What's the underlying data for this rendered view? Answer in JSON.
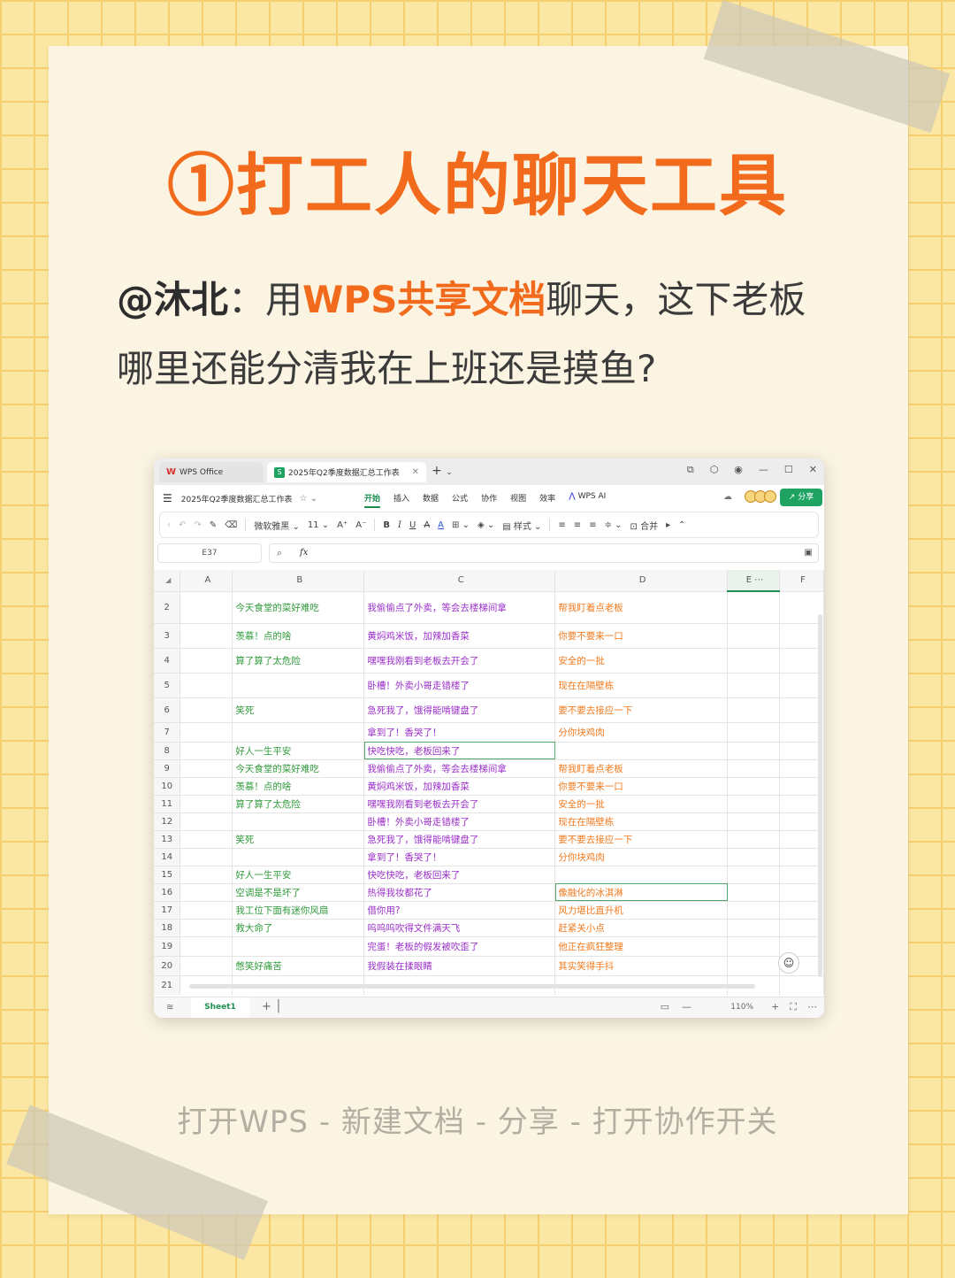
{
  "headline": "①打工人的聊天工具",
  "quote": {
    "author": "@沐北",
    "colon": "：用",
    "highlight": "WPS共享文档",
    "rest1": "聊天，这下老板",
    "line2": "哪里还能分清我在上班还是摸鱼?"
  },
  "footer_steps": "打开WPS - 新建文档 - 分享 - 打开协作开关",
  "window": {
    "tab_home": "WPS Office",
    "tab_doc": "2025年Q2季度数据汇总工作表",
    "doc_name": "2025年Q2季度数据汇总工作表",
    "menus": [
      "开始",
      "插入",
      "数据",
      "公式",
      "协作",
      "视图",
      "效率"
    ],
    "ai_label": "WPS AI",
    "share_label": "分享",
    "font_name": "微软雅黑",
    "font_size": "11",
    "style_label": "样式",
    "merge_label": "合并",
    "cell_ref": "E37",
    "fx_label": "fx",
    "sheet_name": "Sheet1",
    "zoom": "110%",
    "colors": {
      "accent": "#1ea363",
      "orange": "#f26a1b",
      "col_b": "#2f9a3a",
      "col_c": "#9b2fc9",
      "col_d": "#f07a1e"
    }
  },
  "columns": [
    "A",
    "B",
    "C",
    "D",
    "E",
    "F"
  ],
  "rows": [
    {
      "n": "2",
      "b": "今天食堂的菜好难吃",
      "c": "我偷偷点了外卖，等会去楼梯间拿",
      "d": "帮我盯着点老板"
    },
    {
      "n": "3",
      "b": "羡慕！点的啥",
      "c": "黄焖鸡米饭，加辣加香菜",
      "d": "你要不要来一口"
    },
    {
      "n": "4",
      "b": "算了算了太危险",
      "c": "嘿嘿我刚看到老板去开会了",
      "d": "安全的一批"
    },
    {
      "n": "5",
      "b": "",
      "c": "卧槽！外卖小哥走错楼了",
      "d": "现在在隔壁栋"
    },
    {
      "n": "6",
      "b": "笑死",
      "c": "急死我了，饿得能啃键盘了",
      "d": "要不要去接应一下"
    },
    {
      "n": "7",
      "b": "",
      "c": "拿到了！香哭了！",
      "d": "分你块鸡肉"
    },
    {
      "n": "8",
      "b": "好人一生平安",
      "c": "快吃快吃，老板回来了",
      "d": ""
    },
    {
      "n": "9",
      "b": "今天食堂的菜好难吃",
      "c": "我偷偷点了外卖，等会去楼梯间拿",
      "d": "帮我盯着点老板"
    },
    {
      "n": "10",
      "b": "羡慕！点的啥",
      "c": "黄焖鸡米饭，加辣加香菜",
      "d": "你要不要来一口"
    },
    {
      "n": "11",
      "b": "算了算了太危险",
      "c": "嘿嘿我刚看到老板去开会了",
      "d": "安全的一批"
    },
    {
      "n": "12",
      "b": "",
      "c": "卧槽！外卖小哥走错楼了",
      "d": "现在在隔壁栋"
    },
    {
      "n": "13",
      "b": "笑死",
      "c": "急死我了，饿得能啃键盘了",
      "d": "要不要去接应一下"
    },
    {
      "n": "14",
      "b": "",
      "c": "拿到了！香哭了！",
      "d": "分你块鸡肉"
    },
    {
      "n": "15",
      "b": "好人一生平安",
      "c": "快吃快吃，老板回来了",
      "d": ""
    },
    {
      "n": "16",
      "b": "空调是不是坏了",
      "c": "热得我妆都花了",
      "d": "像融化的冰淇淋"
    },
    {
      "n": "17",
      "b": "我工位下面有迷你风扇",
      "c": "借你用?",
      "d": "风力堪比直升机"
    },
    {
      "n": "18",
      "b": "救大命了",
      "c": "呜呜呜吹得文件满天飞",
      "d": "赶紧关小点"
    },
    {
      "n": "19",
      "b": "",
      "c": "完蛋！老板的假发被吹歪了",
      "d": "他正在疯狂整理"
    },
    {
      "n": "20",
      "b": "憋笑好痛苦",
      "c": "我假装在揉眼睛",
      "d": "其实笑得手抖"
    },
    {
      "n": "21",
      "b": "",
      "c": "",
      "d": ""
    }
  ]
}
